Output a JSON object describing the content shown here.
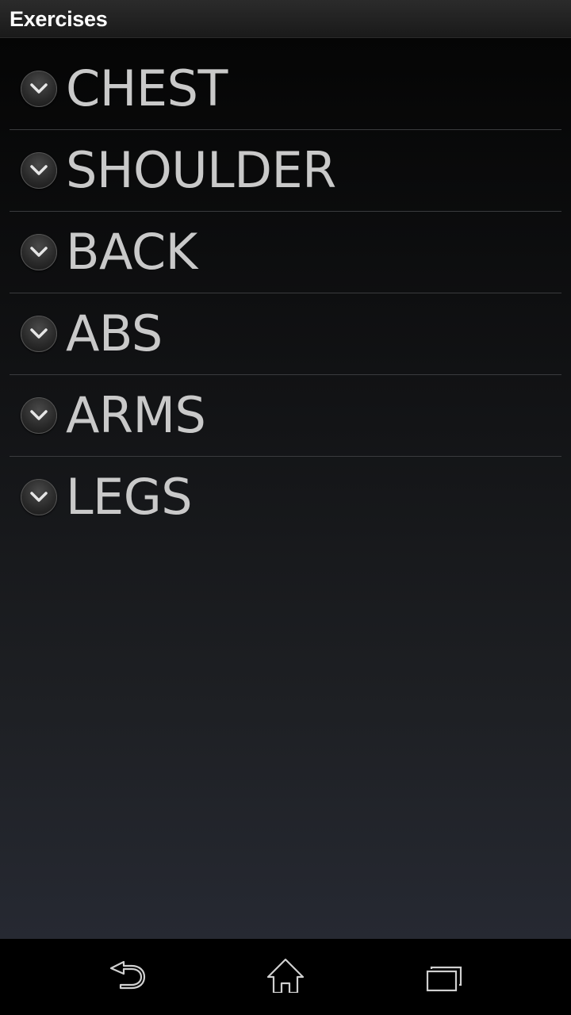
{
  "app": {
    "title": "Exercises"
  },
  "groups": [
    {
      "label": "CHEST",
      "icon": "chevron-down-icon"
    },
    {
      "label": "SHOULDER",
      "icon": "chevron-down-icon"
    },
    {
      "label": "BACK",
      "icon": "chevron-down-icon"
    },
    {
      "label": "ABS",
      "icon": "chevron-down-icon"
    },
    {
      "label": "ARMS",
      "icon": "chevron-down-icon"
    },
    {
      "label": "LEGS",
      "icon": "chevron-down-icon"
    }
  ],
  "navigation": {
    "back_icon": "back-icon",
    "home_icon": "home-icon",
    "recents_icon": "recent-apps-icon"
  },
  "colors": {
    "background_top": "#050505",
    "background_bottom": "#262932",
    "label_text": "#c9c9c9",
    "divider": "#3a3b3e",
    "title_text": "#ffffff"
  }
}
